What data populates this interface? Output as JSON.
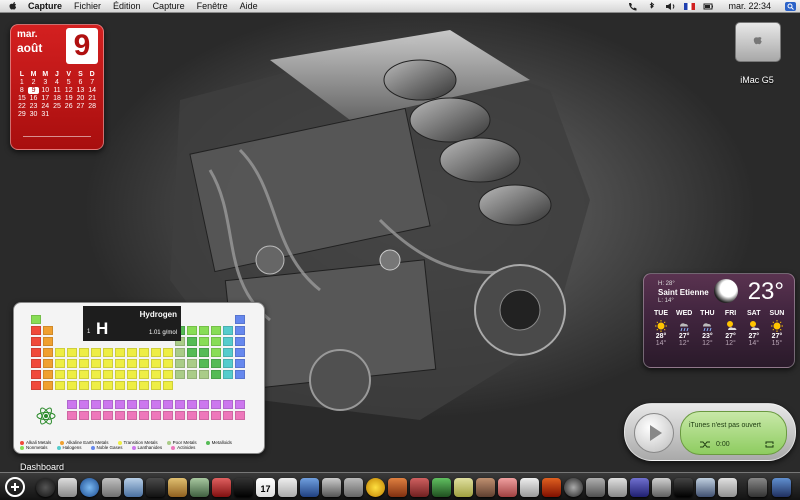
{
  "menubar": {
    "app_name": "Capture",
    "items": [
      "Fichier",
      "Édition",
      "Capture",
      "Fenêtre",
      "Aide"
    ],
    "clock": "mar. 22:34"
  },
  "calendar": {
    "weekday": "mar.",
    "month": "août",
    "date": "9",
    "headers": [
      "L",
      "M",
      "M",
      "J",
      "V",
      "S",
      "D"
    ],
    "cells": [
      "1",
      "2",
      "3",
      "4",
      "5",
      "6",
      "7",
      "8",
      "9",
      "10",
      "11",
      "12",
      "13",
      "14",
      "15",
      "16",
      "17",
      "18",
      "19",
      "20",
      "21",
      "22",
      "23",
      "24",
      "25",
      "26",
      "27",
      "28",
      "29",
      "30",
      "31",
      "",
      "",
      "",
      ""
    ],
    "today": "9"
  },
  "desktop": {
    "disk_label": "iMac G5",
    "dashboard_label": "Dashboard"
  },
  "weather": {
    "high": "H: 28°",
    "city": "Saint Etienne",
    "low": "L: 14°",
    "temp": "23°",
    "forecast": [
      {
        "day": "TUE",
        "icon": "sun-icon",
        "hi": "28°",
        "lo": "14°"
      },
      {
        "day": "WED",
        "icon": "rain-icon",
        "hi": "27°",
        "lo": "12°"
      },
      {
        "day": "THU",
        "icon": "rain-icon",
        "hi": "23°",
        "lo": "12°"
      },
      {
        "day": "FRI",
        "icon": "partly-cloudy-icon",
        "hi": "27°",
        "lo": "12°"
      },
      {
        "day": "SAT",
        "icon": "partly-cloudy-icon",
        "hi": "27°",
        "lo": "14°"
      },
      {
        "day": "SUN",
        "icon": "sun-icon",
        "hi": "27°",
        "lo": "15°"
      }
    ]
  },
  "ptable": {
    "selected": {
      "number": "1",
      "symbol": "H",
      "name": "Hydrogen",
      "mass": "1.01 g/mol"
    },
    "legend": [
      {
        "label": "Alkali Metals",
        "color": "#f04a3a"
      },
      {
        "label": "Alkaline Earth Metals",
        "color": "#f0a030"
      },
      {
        "label": "Transition Metals",
        "color": "#eeee44"
      },
      {
        "label": "Poor Metals",
        "color": "#aacc88"
      },
      {
        "label": "Metalloids",
        "color": "#55bb55"
      },
      {
        "label": "Nonmetals",
        "color": "#88dd55"
      },
      {
        "label": "Halogens",
        "color": "#55cccc"
      },
      {
        "label": "Noble Gases",
        "color": "#6688ee"
      },
      {
        "label": "Lanthanides",
        "color": "#cc77ee"
      },
      {
        "label": "Actinides",
        "color": "#ee77bb"
      }
    ]
  },
  "itunes": {
    "message": "iTunes n'est pas ouvert",
    "time": "0:00"
  }
}
